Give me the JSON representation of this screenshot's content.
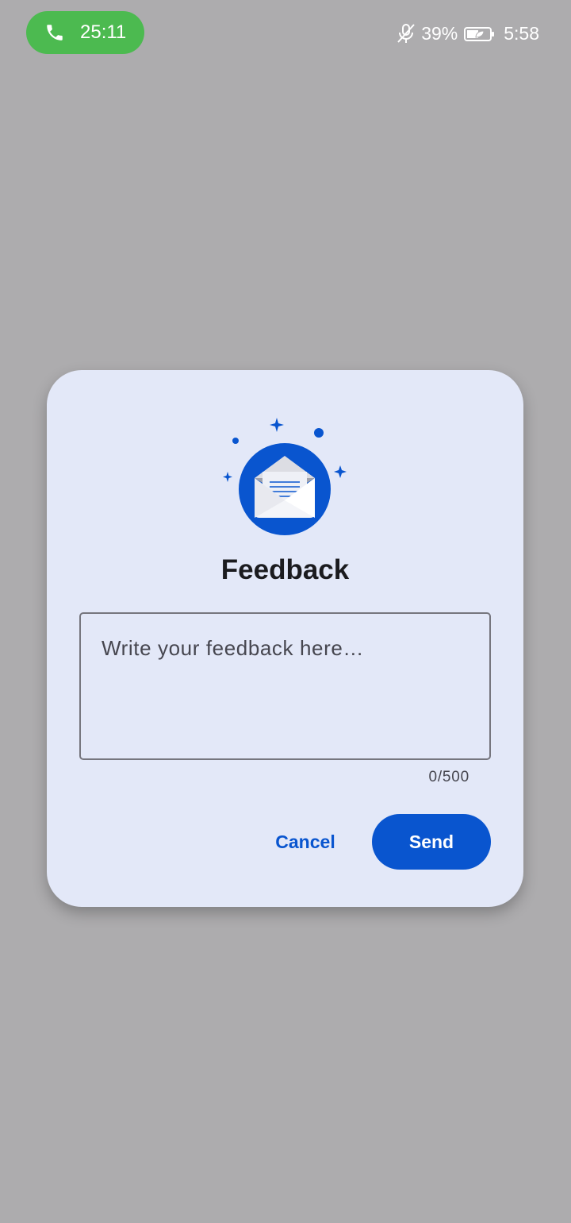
{
  "status_bar": {
    "call_timer": "25:11",
    "battery_percent": "39%",
    "clock": "5:58",
    "icons": [
      "phone-icon",
      "mic-off-icon",
      "battery-saver-icon"
    ]
  },
  "dialog": {
    "icon": "feedback-envelope-icon",
    "title": "Feedback",
    "input": {
      "placeholder": "Write your feedback here…",
      "value": ""
    },
    "counter": "0/500",
    "cancel_label": "Cancel",
    "send_label": "Send"
  },
  "colors": {
    "scrim": "#adacae",
    "dialog_bg": "#e3e8f8",
    "accent": "#0955cf",
    "call_pill": "#4cba50"
  }
}
